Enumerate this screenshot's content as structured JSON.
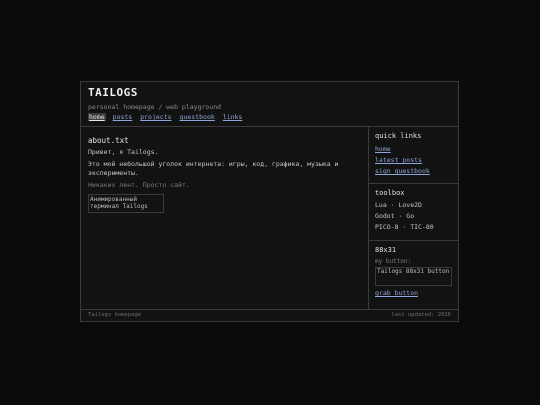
{
  "header": {
    "title": "TAILOGS",
    "tagline": "personal homepage / web playground"
  },
  "nav": [
    "home",
    "posts",
    "projects",
    "guestbook",
    "links"
  ],
  "main": {
    "heading": "about.txt",
    "p1": "Привет, я Tailogs.",
    "p2": "Это мой небольшой уголок интернета: игры, код, графика, музыка и эксперименты.",
    "p3": "Никаких лент. Просто сайт.",
    "image_alt": "Анимированный терминал Tailogs"
  },
  "sidebar": {
    "quick_links": {
      "title": "quick links",
      "items": [
        "home",
        "latest posts",
        "sign guestbook"
      ]
    },
    "toolbox": {
      "title": "toolbox",
      "items": [
        "Lua · Love2D",
        "Godot · Go",
        "PICO-8 · TIC-80"
      ]
    },
    "button_88x31": {
      "title": "88x31",
      "caption": "my button:",
      "image_alt": "Tailogs 88x31 button",
      "grab": "grab button"
    }
  },
  "footer": {
    "left": "Tailogs homepage",
    "right": "last updated: 2026"
  }
}
